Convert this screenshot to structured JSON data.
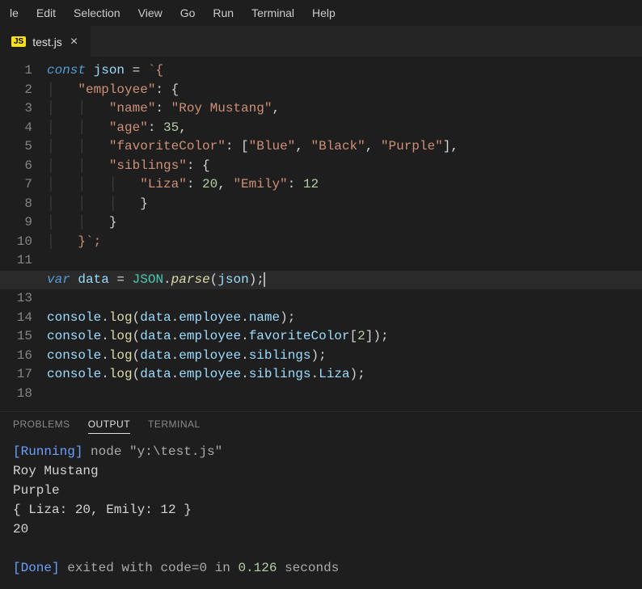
{
  "menu": {
    "items": [
      "le",
      "Edit",
      "Selection",
      "View",
      "Go",
      "Run",
      "Terminal",
      "Help"
    ]
  },
  "tabs": [
    {
      "icon": "JS",
      "label": "test.js",
      "close": "×"
    }
  ],
  "panel": {
    "tabs": [
      "PROBLEMS",
      "OUTPUT",
      "TERMINAL"
    ],
    "active_tab": 1,
    "output": {
      "running_label": "[Running]",
      "running_cmd": " node \"y:\\test.js\"",
      "lines": [
        "Roy Mustang",
        "Purple",
        "{ Liza: 20, Emily: 12 }",
        "20"
      ],
      "done_label": "[Done]",
      "done_text_1": " exited with ",
      "done_code": "code=0",
      "done_text_2": " in ",
      "done_time": "0.126",
      "done_text_3": " seconds"
    }
  },
  "editor": {
    "current_line": 12,
    "line_count": 18,
    "code": {
      "const_kw": "const",
      "json_var": "json",
      "eq": " = ",
      "tick_open": "`{",
      "emp_key": "\"employee\"",
      "colon_brace": ": {",
      "name_key": "\"name\"",
      "name_val": "\"Roy Mustang\"",
      "comma": ",",
      "age_key": "\"age\"",
      "age_val": "35",
      "fav_key": "\"favoriteColor\"",
      "arr_open": ": [",
      "blue": "\"Blue\"",
      "black": "\"Black\"",
      "purple": "\"Purple\"",
      "arr_close": "],",
      "sib_key": "\"siblings\"",
      "liza_key": "\"Liza\"",
      "liza_val": "20",
      "emily_key": "\"Emily\"",
      "emily_val": "12",
      "close_brace": "}",
      "close_tick": "}`;",
      "var_kw": "var",
      "data_var": "data",
      "JSON": "JSON",
      "parse": "parse",
      "json_arg": "json",
      "console": "console",
      "log": "log",
      "data_ref": "data",
      "employee": "employee",
      "name": "name",
      "favoriteColor": "favoriteColor",
      "idx2": "2",
      "siblings": "siblings",
      "Liza": "Liza"
    }
  }
}
